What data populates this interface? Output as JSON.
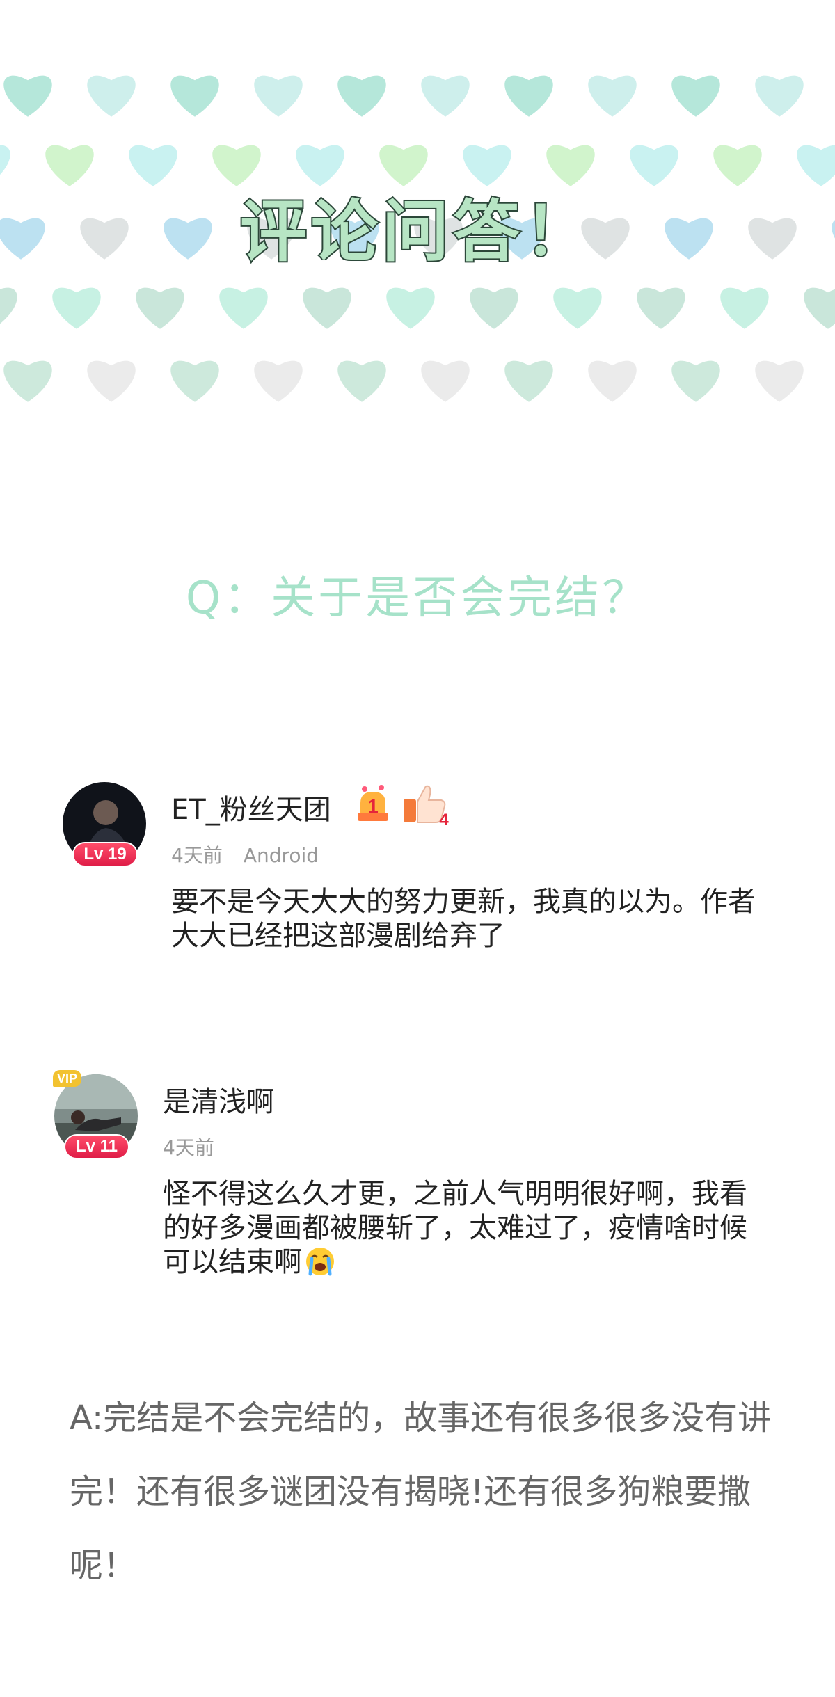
{
  "banner": {
    "title": "评论问答！",
    "heart_palette": [
      "#a8e3d3",
      "#b9dfe9",
      "#bfe2d3",
      "#c9f2c3",
      "#cfe5e0",
      "#e7e7e7",
      "#b0dcee",
      "#c6ece9",
      "#d3d9d5",
      "#bdeede",
      "#bff0ee",
      "#dfe7e4",
      "#c4e5d6",
      "#d9dede"
    ]
  },
  "question": "Q：关于是否会完结？",
  "comments": [
    {
      "username": "ET_粉丝天团",
      "level": "Lv 19",
      "time": "4天前",
      "device": "Android",
      "text": "要不是今天大大的努力更新，我真的以为。作者大大已经把这部漫剧给弃了",
      "medals": [
        "medal-1-icon",
        "medal-4-thumb-icon"
      ],
      "medal_4_count": "4"
    },
    {
      "username": "是清浅啊",
      "level": "Lv 11",
      "vip": "VIP",
      "time": "4天前",
      "text": "怪不得这么久才更，之前人气明明很好啊，我看的好多漫画都被腰斩了，太难过了，疫情啥时候可以结束啊",
      "emoji": "crying-face-icon"
    }
  ],
  "answer": {
    "text": "A:完结是不会完结的，故事还有很多很多没有讲完！还有很多谜团没有揭晓!还有很多狗粮要撒呢！"
  }
}
